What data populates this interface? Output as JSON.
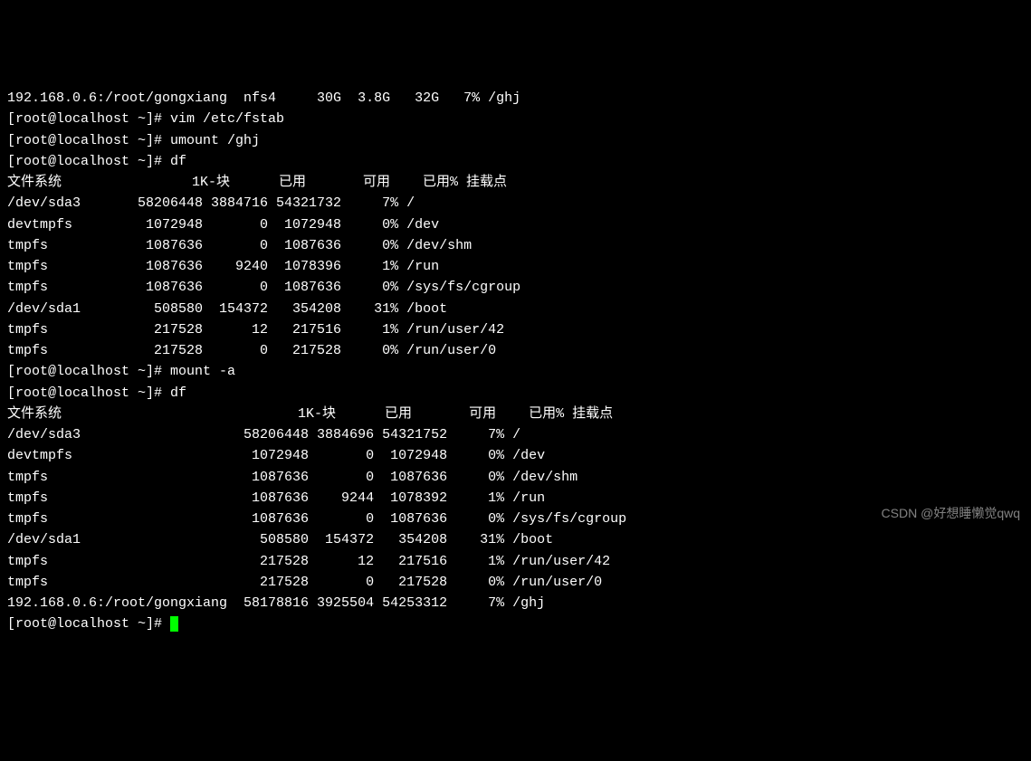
{
  "prompt": "[root@localhost ~]# ",
  "top_truncated": "192.168.0.6:/root/gongxiang  nfs4     30G  3.8G   32G   7% /ghj",
  "cmd1": "vim /etc/fstab",
  "cmd2": "umount /ghj",
  "cmd3": "df",
  "cmd4": "mount -a",
  "cmd5": "df",
  "df1_header": {
    "fs": "文件系统",
    "blocks": "1K-块",
    "used": "已用",
    "avail": "可用",
    "usep": "已用%",
    "mount": "挂载点"
  },
  "df1_rows": [
    {
      "fs": "/dev/sda3",
      "blocks": "58206448",
      "used": "3884716",
      "avail": "54321732",
      "usep": "7%",
      "mount": "/"
    },
    {
      "fs": "devtmpfs",
      "blocks": "1072948",
      "used": "0",
      "avail": "1072948",
      "usep": "0%",
      "mount": "/dev"
    },
    {
      "fs": "tmpfs",
      "blocks": "1087636",
      "used": "0",
      "avail": "1087636",
      "usep": "0%",
      "mount": "/dev/shm"
    },
    {
      "fs": "tmpfs",
      "blocks": "1087636",
      "used": "9240",
      "avail": "1078396",
      "usep": "1%",
      "mount": "/run"
    },
    {
      "fs": "tmpfs",
      "blocks": "1087636",
      "used": "0",
      "avail": "1087636",
      "usep": "0%",
      "mount": "/sys/fs/cgroup"
    },
    {
      "fs": "/dev/sda1",
      "blocks": "508580",
      "used": "154372",
      "avail": "354208",
      "usep": "31%",
      "mount": "/boot"
    },
    {
      "fs": "tmpfs",
      "blocks": "217528",
      "used": "12",
      "avail": "217516",
      "usep": "1%",
      "mount": "/run/user/42"
    },
    {
      "fs": "tmpfs",
      "blocks": "217528",
      "used": "0",
      "avail": "217528",
      "usep": "0%",
      "mount": "/run/user/0"
    }
  ],
  "df2_header": {
    "fs": "文件系统",
    "blocks": "1K-块",
    "used": "已用",
    "avail": "可用",
    "usep": "已用%",
    "mount": "挂载点"
  },
  "df2_rows": [
    {
      "fs": "/dev/sda3",
      "blocks": "58206448",
      "used": "3884696",
      "avail": "54321752",
      "usep": "7%",
      "mount": "/"
    },
    {
      "fs": "devtmpfs",
      "blocks": "1072948",
      "used": "0",
      "avail": "1072948",
      "usep": "0%",
      "mount": "/dev"
    },
    {
      "fs": "tmpfs",
      "blocks": "1087636",
      "used": "0",
      "avail": "1087636",
      "usep": "0%",
      "mount": "/dev/shm"
    },
    {
      "fs": "tmpfs",
      "blocks": "1087636",
      "used": "9244",
      "avail": "1078392",
      "usep": "1%",
      "mount": "/run"
    },
    {
      "fs": "tmpfs",
      "blocks": "1087636",
      "used": "0",
      "avail": "1087636",
      "usep": "0%",
      "mount": "/sys/fs/cgroup"
    },
    {
      "fs": "/dev/sda1",
      "blocks": "508580",
      "used": "154372",
      "avail": "354208",
      "usep": "31%",
      "mount": "/boot"
    },
    {
      "fs": "tmpfs",
      "blocks": "217528",
      "used": "12",
      "avail": "217516",
      "usep": "1%",
      "mount": "/run/user/42"
    },
    {
      "fs": "tmpfs",
      "blocks": "217528",
      "used": "0",
      "avail": "217528",
      "usep": "0%",
      "mount": "/run/user/0"
    },
    {
      "fs": "192.168.0.6:/root/gongxiang",
      "blocks": "58178816",
      "used": "3925504",
      "avail": "54253312",
      "usep": "7%",
      "mount": "/ghj"
    }
  ],
  "watermark": "CSDN @好想睡懒觉qwq",
  "col1": {
    "fs": 15,
    "blocks": 9,
    "used": 8,
    "avail": 9,
    "usep": 6
  },
  "col2": {
    "fs": 28,
    "blocks": 9,
    "used": 8,
    "avail": 9,
    "usep": 6
  }
}
